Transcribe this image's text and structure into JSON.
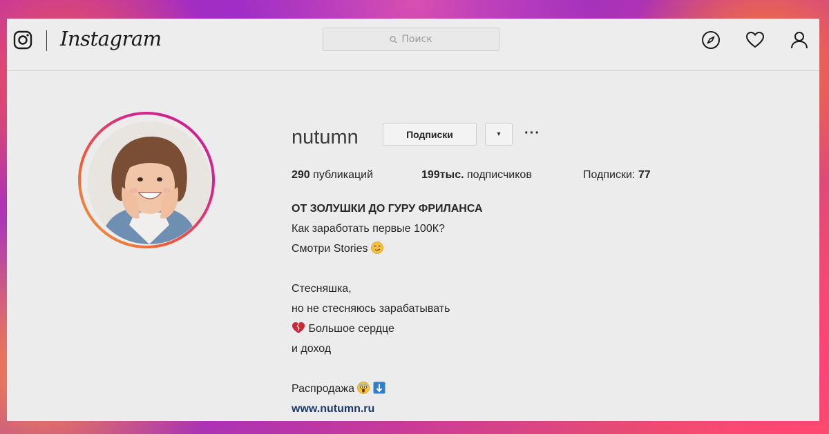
{
  "header": {
    "wordmark": "Instagram",
    "search_placeholder": "Поиск",
    "icons": [
      "instagram-glyph-icon",
      "compass-icon",
      "heart-icon",
      "profile-icon"
    ]
  },
  "profile": {
    "username": "nutumn",
    "follow_button_label": "Подписки",
    "dropdown_glyph": "▾",
    "more_glyph": "···",
    "stats": {
      "posts_count": "290",
      "posts_label": "публикаций",
      "followers_count": "199тыс.",
      "followers_label": "подписчиков",
      "following_label": "Подписки:",
      "following_count": "77"
    },
    "bio": {
      "title": "ОТ ЗОЛУШКИ ДО ГУРУ ФРИЛАНСА",
      "line1": "Как заработать первые 100К?",
      "line2": "Смотри Stories",
      "line3": "Стесняшка,",
      "line4": "но не стесняюсь зарабатывать",
      "line5": "Большое сердце",
      "line6": "и доход",
      "line7": "Распродажа",
      "link": "www.nutumn.ru"
    }
  },
  "colors": {
    "ring_start": "#f2a03d",
    "ring_end": "#c8208f",
    "link": "#1d3a6b",
    "card_bg": "#ececec"
  }
}
